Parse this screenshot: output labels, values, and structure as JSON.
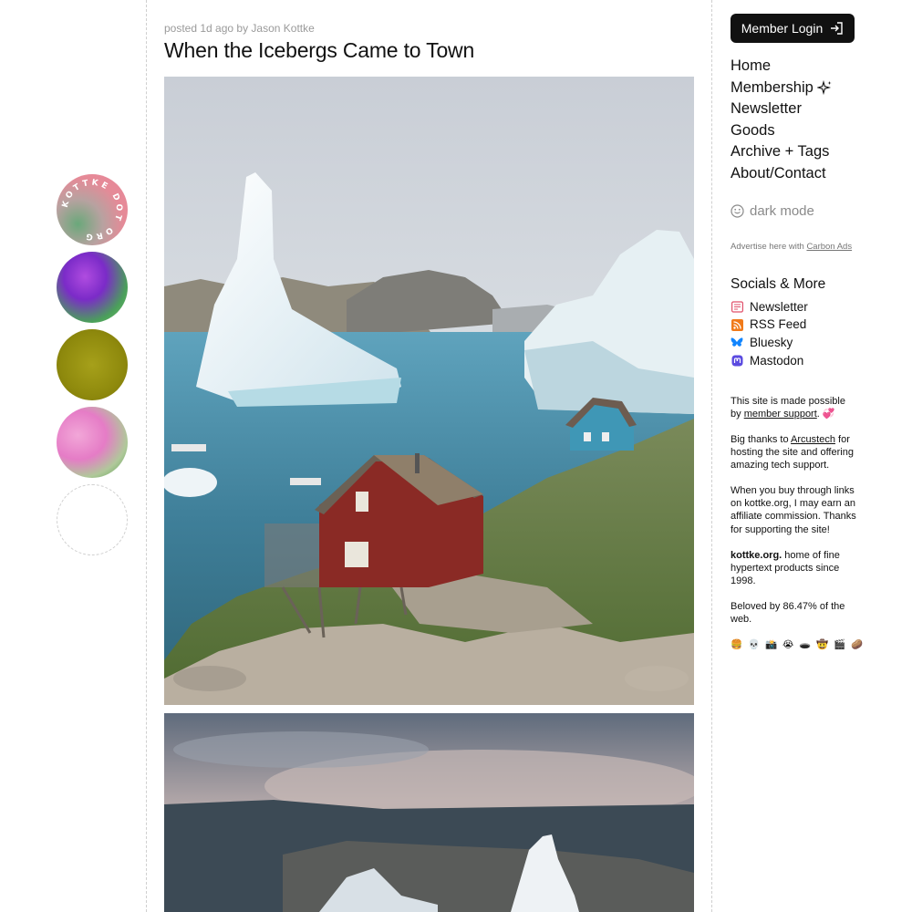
{
  "article": {
    "meta": "posted 1d ago by Jason Kottke",
    "title": "When the Icebergs Came to Town"
  },
  "badges": {
    "logo_text": "KOTTKE DOT ORG"
  },
  "sidebar": {
    "login_label": "Member Login",
    "nav": [
      {
        "label": "Home"
      },
      {
        "label": "Membership",
        "icon": "sparkles-icon"
      },
      {
        "label": "Newsletter"
      },
      {
        "label": "Goods"
      },
      {
        "label": "Archive + Tags"
      },
      {
        "label": "About/Contact"
      }
    ],
    "dark_mode_label": "dark mode",
    "advertise_prefix": "Advertise here with",
    "advertise_link": "Carbon Ads",
    "socials_heading": "Socials & More",
    "socials": [
      {
        "label": "Newsletter",
        "icon": "newsletter-icon",
        "color": "#e0506a"
      },
      {
        "label": "RSS Feed",
        "icon": "rss-icon",
        "color": "#f07a1a"
      },
      {
        "label": "Bluesky",
        "icon": "butterfly-icon",
        "color": "#1185fe"
      },
      {
        "label": "Mastodon",
        "icon": "mastodon-icon",
        "color": "#5b4be0"
      }
    ],
    "support_pre": "This site is made possible by",
    "support_link": "member support",
    "support_post": ". 💞",
    "thanks_pre": "Big thanks to",
    "thanks_link": "Arcustech",
    "thanks_post": "for hosting the site and offering amazing tech support.",
    "affiliate": "When you buy through links on kottke.org, I may earn an affiliate commission. Thanks for supporting the site!",
    "home_bold": "kottke.org.",
    "home_rest": "home of fine hypertext products since 1998.",
    "beloved": "Beloved by 86.47% of the web.",
    "emojis": "🍔 💀 📸 😭 🕳️ 🤠 🎬 🥔"
  }
}
